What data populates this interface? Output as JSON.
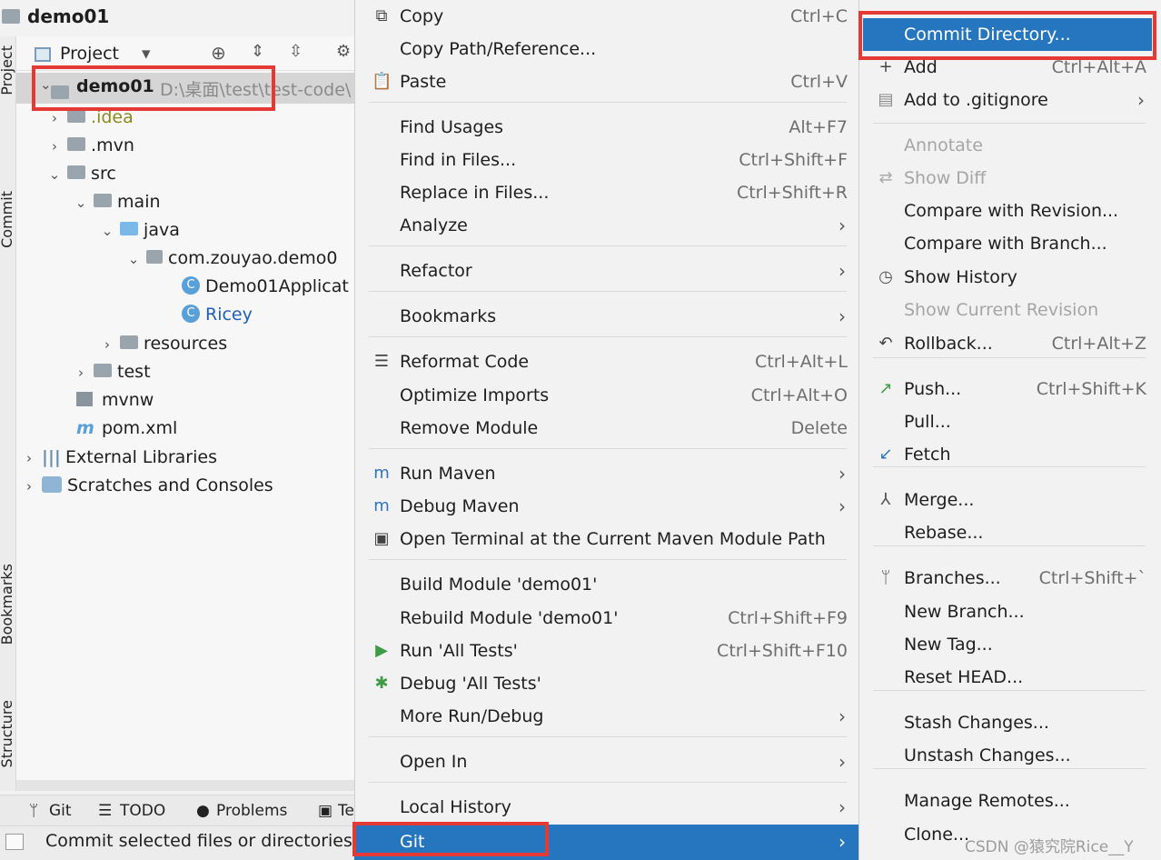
{
  "project": {
    "window_title": "demo01",
    "header_label": "Project",
    "root_name": "demo01",
    "root_path": "D:\\桌面\\test\\test-code\\",
    "tree": [
      ".idea",
      ".mvn",
      "src",
      "main",
      "java",
      "com.zouyao.demo0",
      "Demo01Applicat",
      "Ricey",
      "resources",
      "test",
      "mvnw",
      "pom.xml",
      "External Libraries",
      "Scratches and Consoles"
    ]
  },
  "side_tabs": [
    "Project",
    "Commit",
    "Bookmarks",
    "Structure"
  ],
  "bottom_tabs": [
    "Git",
    "TODO",
    "Problems",
    "Te"
  ],
  "status_text": "Commit selected files or directories",
  "context_menu": [
    {
      "label": "Copy",
      "shortcut": "Ctrl+C"
    },
    {
      "label": "Copy Path/Reference...",
      "shortcut": ""
    },
    {
      "label": "Paste",
      "shortcut": "Ctrl+V"
    },
    {
      "label": "Find Usages",
      "shortcut": "Alt+F7"
    },
    {
      "label": "Find in Files...",
      "shortcut": "Ctrl+Shift+F"
    },
    {
      "label": "Replace in Files...",
      "shortcut": "Ctrl+Shift+R"
    },
    {
      "label": "Analyze",
      "shortcut": ""
    },
    {
      "label": "Refactor",
      "shortcut": ""
    },
    {
      "label": "Bookmarks",
      "shortcut": ""
    },
    {
      "label": "Reformat Code",
      "shortcut": "Ctrl+Alt+L"
    },
    {
      "label": "Optimize Imports",
      "shortcut": "Ctrl+Alt+O"
    },
    {
      "label": "Remove Module",
      "shortcut": "Delete"
    },
    {
      "label": "Run Maven",
      "shortcut": ""
    },
    {
      "label": "Debug Maven",
      "shortcut": ""
    },
    {
      "label": "Open Terminal at the Current Maven Module Path",
      "shortcut": ""
    },
    {
      "label": "Build Module 'demo01'",
      "shortcut": ""
    },
    {
      "label": "Rebuild Module 'demo01'",
      "shortcut": "Ctrl+Shift+F9"
    },
    {
      "label": "Run 'All Tests'",
      "shortcut": "Ctrl+Shift+F10"
    },
    {
      "label": "Debug 'All Tests'",
      "shortcut": ""
    },
    {
      "label": "More Run/Debug",
      "shortcut": ""
    },
    {
      "label": "Open In",
      "shortcut": ""
    },
    {
      "label": "Local History",
      "shortcut": ""
    },
    {
      "label": "Git",
      "shortcut": ""
    }
  ],
  "git_menu": [
    {
      "label": "Commit Directory...",
      "shortcut": ""
    },
    {
      "label": "Add",
      "shortcut": "Ctrl+Alt+A"
    },
    {
      "label": "Add to .gitignore",
      "shortcut": ""
    },
    {
      "label": "Annotate",
      "shortcut": ""
    },
    {
      "label": "Show Diff",
      "shortcut": ""
    },
    {
      "label": "Compare with Revision...",
      "shortcut": ""
    },
    {
      "label": "Compare with Branch...",
      "shortcut": ""
    },
    {
      "label": "Show History",
      "shortcut": ""
    },
    {
      "label": "Show Current Revision",
      "shortcut": ""
    },
    {
      "label": "Rollback...",
      "shortcut": "Ctrl+Alt+Z"
    },
    {
      "label": "Push...",
      "shortcut": "Ctrl+Shift+K"
    },
    {
      "label": "Pull...",
      "shortcut": ""
    },
    {
      "label": "Fetch",
      "shortcut": ""
    },
    {
      "label": "Merge...",
      "shortcut": ""
    },
    {
      "label": "Rebase...",
      "shortcut": ""
    },
    {
      "label": "Branches...",
      "shortcut": "Ctrl+Shift+`"
    },
    {
      "label": "New Branch...",
      "shortcut": ""
    },
    {
      "label": "New Tag...",
      "shortcut": ""
    },
    {
      "label": "Reset HEAD...",
      "shortcut": ""
    },
    {
      "label": "Stash Changes...",
      "shortcut": ""
    },
    {
      "label": "Unstash Changes...",
      "shortcut": ""
    },
    {
      "label": "Manage Remotes...",
      "shortcut": ""
    },
    {
      "label": "Clone...",
      "shortcut": ""
    }
  ],
  "watermark": "CSDN @猿究院Rice__Y",
  "colors": {
    "highlight": "#2675bf",
    "annotation_red": "#e53935"
  }
}
